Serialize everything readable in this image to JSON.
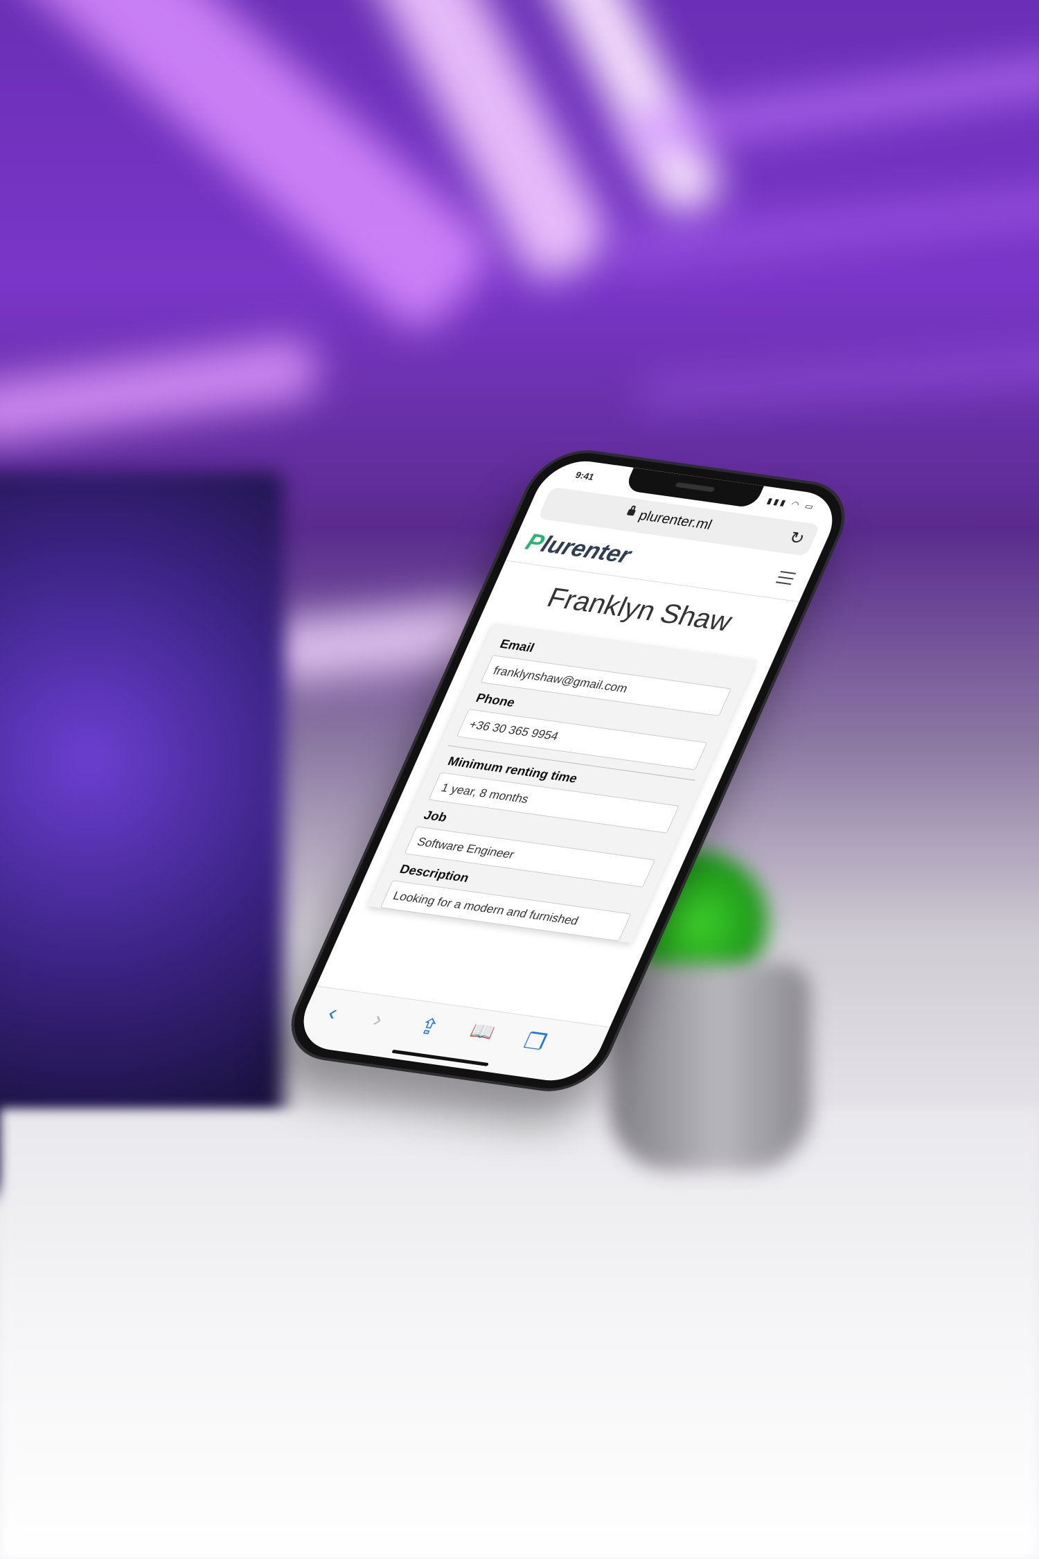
{
  "status": {
    "time": "9:41",
    "indicators": "▮▮▮ ◠ ▭"
  },
  "browser": {
    "url": "plurenter.ml",
    "reload_icon": "reload-icon",
    "lock_icon": "lock-icon"
  },
  "site": {
    "logo_initial": "P",
    "logo_rest": "lurenter",
    "menu_icon": "hamburger-menu-icon"
  },
  "profile": {
    "name": "Franklyn Shaw",
    "fields": {
      "email_label": "Email",
      "email_value": "franklynshaw@gmail.com",
      "phone_label": "Phone",
      "phone_value": "+36 30 365 9954",
      "min_time_label": "Minimum renting time",
      "min_time_value": "1 year, 8 months",
      "job_label": "Job",
      "job_value": "Software Engineer",
      "description_label": "Description",
      "description_value": "Looking for a modern and furnished"
    }
  },
  "toolbar": {
    "back": "‹",
    "forward": "›",
    "share": "⇪",
    "bookmarks": "📖",
    "tabs": "❐"
  },
  "colors": {
    "logo_accent": "#2bb574",
    "logo_text": "#2f3d52",
    "ios_blue": "#1f76e0"
  }
}
